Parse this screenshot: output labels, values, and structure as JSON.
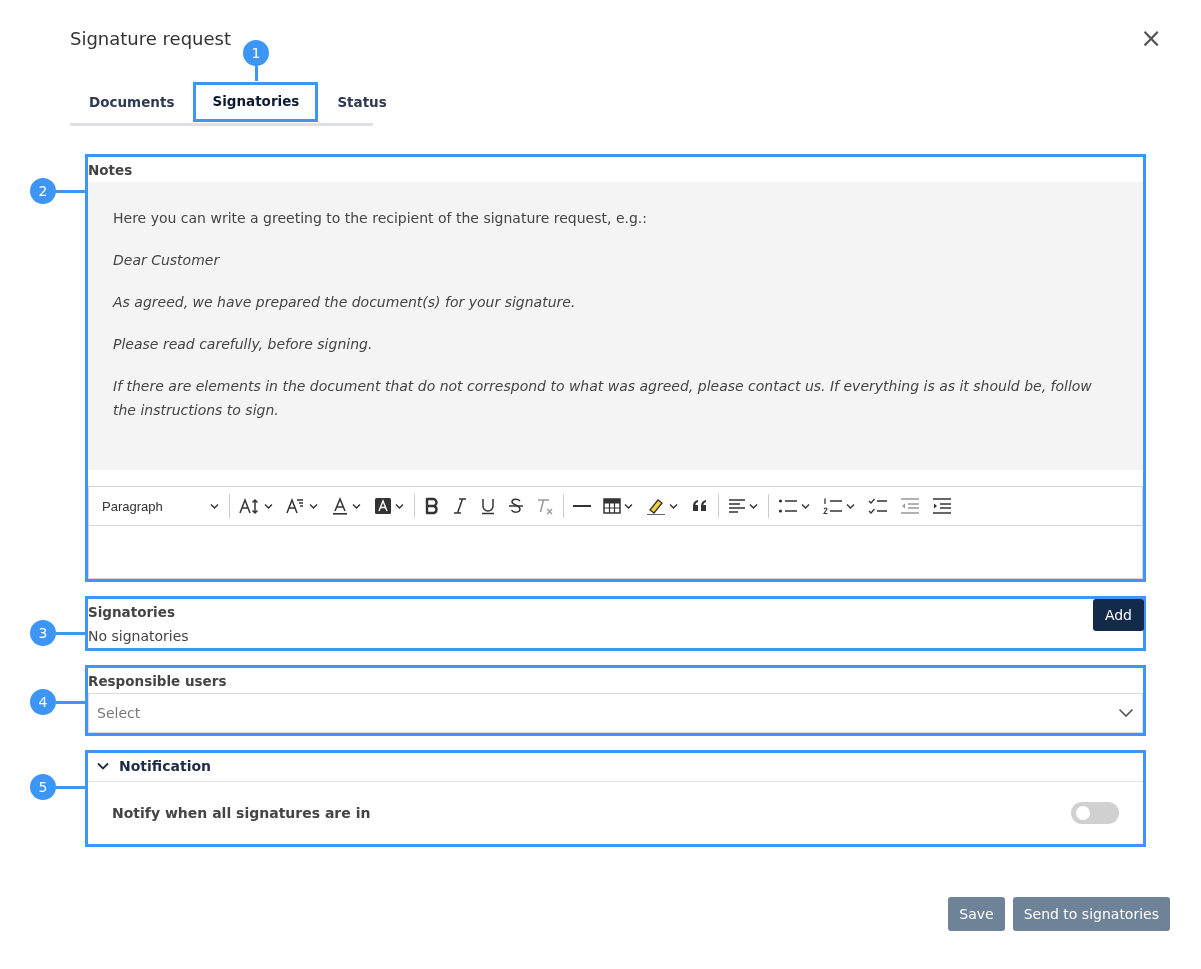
{
  "dialog": {
    "title": "Signature request",
    "close": "×"
  },
  "tabs": [
    {
      "label": "Documents",
      "selected": false
    },
    {
      "label": "Signatories",
      "selected": true,
      "callout": "1"
    },
    {
      "label": "Status",
      "selected": false
    }
  ],
  "notes": {
    "label": "Notes",
    "callout": "2",
    "paragraphs": [
      {
        "text": "Here you can write a greeting to the recipient of the signature request, e.g.:",
        "italic": false
      },
      {
        "text": "Dear Customer",
        "italic": true
      },
      {
        "text": "As agreed, we have prepared the document(s) for your signature.",
        "italic": true
      },
      {
        "text": "Please read carefully, before signing.",
        "italic": true
      },
      {
        "text": "If there are elements in the document that do not correspond to what was agreed, please contact us. If everything is as it should be, follow the instructions to sign.",
        "italic": true
      }
    ],
    "toolbar": [
      {
        "kind": "paragraph",
        "label": "Paragraph",
        "dropdown": true
      },
      {
        "kind": "separator"
      },
      {
        "kind": "font-size",
        "dropdown": true
      },
      {
        "kind": "font-family",
        "dropdown": true
      },
      {
        "kind": "font-color",
        "dropdown": true
      },
      {
        "kind": "background-color",
        "dropdown": true
      },
      {
        "kind": "separator"
      },
      {
        "kind": "bold",
        "dropdown": false
      },
      {
        "kind": "italic",
        "dropdown": false
      },
      {
        "kind": "underline",
        "dropdown": false
      },
      {
        "kind": "strikethrough",
        "dropdown": false
      },
      {
        "kind": "remove-format",
        "dropdown": false
      },
      {
        "kind": "separator"
      },
      {
        "kind": "horizontal-line",
        "dropdown": false
      },
      {
        "kind": "table",
        "dropdown": true
      },
      {
        "kind": "highlight",
        "dropdown": true
      },
      {
        "kind": "blockquote",
        "dropdown": false
      },
      {
        "kind": "separator"
      },
      {
        "kind": "align",
        "dropdown": true
      },
      {
        "kind": "separator"
      },
      {
        "kind": "bulleted-list",
        "dropdown": true
      },
      {
        "kind": "numbered-list",
        "dropdown": true
      },
      {
        "kind": "todo-list",
        "dropdown": false
      },
      {
        "kind": "outdent",
        "dropdown": false
      },
      {
        "kind": "indent",
        "dropdown": false
      }
    ]
  },
  "signatories": {
    "label": "Signatories",
    "callout": "3",
    "add_button": "Add",
    "empty_text": "No signatories"
  },
  "responsible_users": {
    "label": "Responsible users",
    "callout": "4",
    "placeholder": "Select"
  },
  "notification": {
    "label": "Notification",
    "callout": "5",
    "expanded": true,
    "toggle_label": "Notify when all signatures are in",
    "on": false
  },
  "buttons": [
    {
      "label": "Save"
    },
    {
      "label": "Send to signatories"
    }
  ]
}
